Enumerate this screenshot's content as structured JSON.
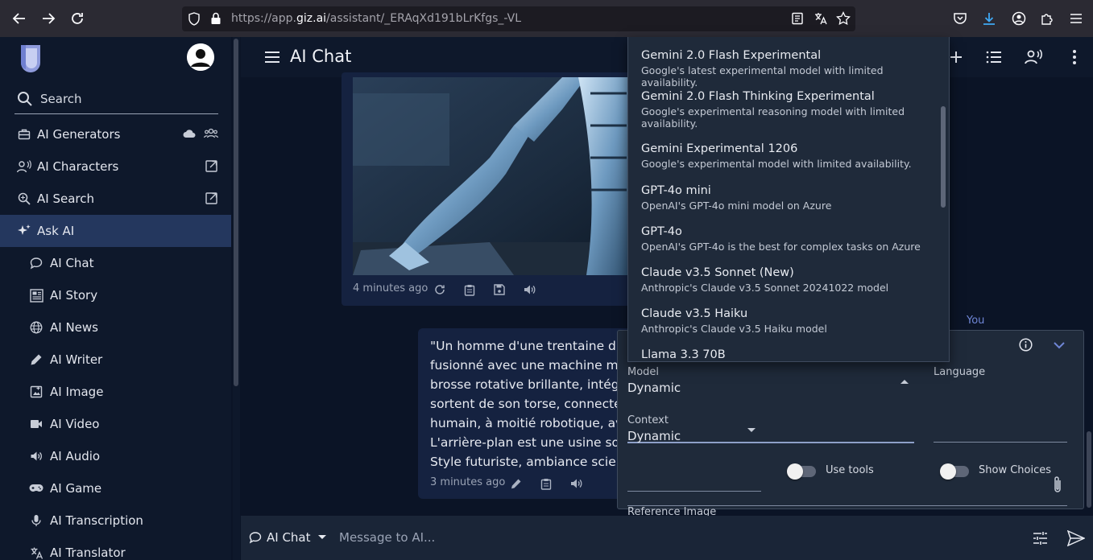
{
  "browser": {
    "url_host": "https://app.",
    "url_domain": "giz.ai",
    "url_path": "/assistant/_ERAqXd191bLrKfgs_-VL"
  },
  "sidebar": {
    "search_label": "Search",
    "items": [
      {
        "label": "AI Generators",
        "icon": "briefcase-icon"
      },
      {
        "label": "AI Characters",
        "icon": "person-voice-icon"
      },
      {
        "label": "AI Search",
        "icon": "search-sparkle-icon"
      },
      {
        "label": "Ask AI",
        "icon": "sparkle-icon"
      },
      {
        "label": "AI Chat",
        "icon": "chat-bubble-icon"
      },
      {
        "label": "AI Story",
        "icon": "story-icon"
      },
      {
        "label": "AI News",
        "icon": "globe-icon"
      },
      {
        "label": "AI Writer",
        "icon": "pen-icon"
      },
      {
        "label": "AI Image",
        "icon": "image-icon"
      },
      {
        "label": "AI Video",
        "icon": "video-icon"
      },
      {
        "label": "AI Audio",
        "icon": "speaker-icon"
      },
      {
        "label": "AI Game",
        "icon": "gamepad-icon"
      },
      {
        "label": "AI Transcription",
        "icon": "microphone-icon"
      },
      {
        "label": "AI Translator",
        "icon": "translate-icon"
      }
    ]
  },
  "header": {
    "title": "AI Chat"
  },
  "chat": {
    "image_time": "4 minutes ago",
    "text_time": "3 minutes ago",
    "you_label": "You",
    "message_lines": [
      "\"Un homme d'une trentaine d'a",
      "fusionné avec une machine mo",
      "brosse rotative brillante, intégré",
      "sortent de son torse, connectés",
      "humain, à moitié robotique, avec",
      "L'arrière-plan est une usine som",
      "Style futuriste, ambiance scienc"
    ]
  },
  "dropdown": {
    "items": [
      {
        "title": "Gemini 2.0 Flash Experimental",
        "desc": "Google's latest experimental model with limited availability."
      },
      {
        "title": "Gemini 2.0 Flash Thinking Experimental",
        "desc": "Google's experimental reasoning model with limited availability."
      },
      {
        "title": "Gemini Experimental 1206",
        "desc": "Google's experimental model with limited availability."
      },
      {
        "title": "GPT-4o mini",
        "desc": "OpenAI's GPT-4o mini model on Azure"
      },
      {
        "title": "GPT-4o",
        "desc": "OpenAI's GPT-4o is the best for complex tasks on Azure"
      },
      {
        "title": "Claude v3.5 Sonnet (New)",
        "desc": "Anthropic's Claude v3.5 Sonnet 20241022 model"
      },
      {
        "title": "Claude v3.5 Haiku",
        "desc": "Anthropic's Claude v3.5 Haiku model"
      },
      {
        "title": "Llama 3.3 70B",
        "desc": ""
      }
    ]
  },
  "settings": {
    "model_label": "Model",
    "model_value": "Dynamic",
    "language_label": "Language",
    "language_value": "",
    "context_label": "Context",
    "context_value": "Dynamic",
    "use_tools_label": "Use tools",
    "use_tools_on": false,
    "show_choices_label": "Show Choices",
    "show_choices_on": false,
    "reference_image_label": "Reference Image"
  },
  "bottom": {
    "mode_label": "AI Chat",
    "input_placeholder": "Message to AI..."
  },
  "colors": {
    "background": "#0b1426",
    "sidebar_active": "#24375e",
    "card": "#152240",
    "panel": "#1f2a3a",
    "accent": "#6f86d6"
  }
}
